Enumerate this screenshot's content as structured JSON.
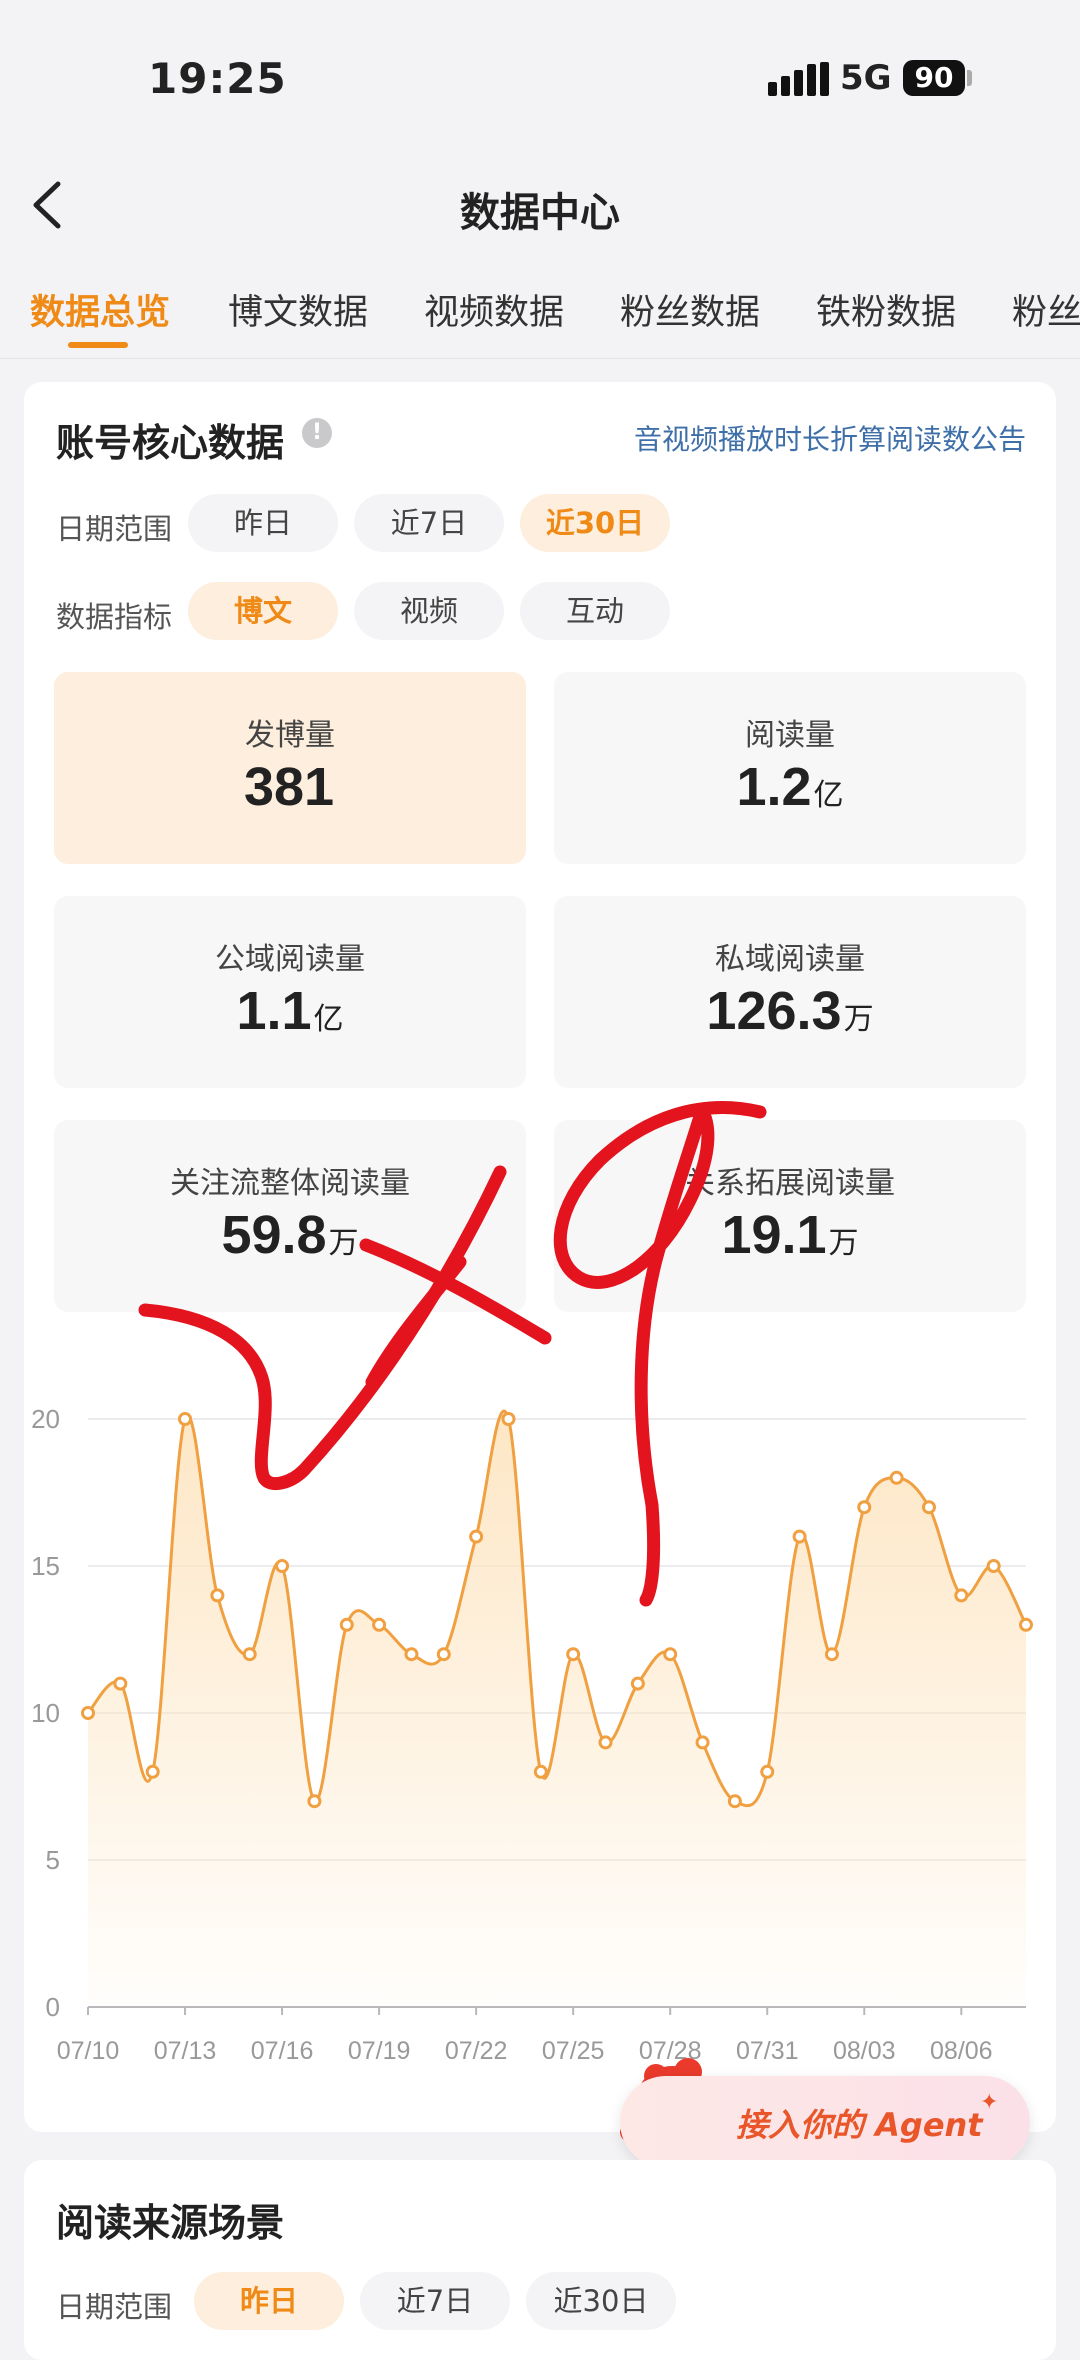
{
  "status_bar": {
    "time": "19:25",
    "network": "5G",
    "battery": "90"
  },
  "nav": {
    "title": "数据中心"
  },
  "tabs": [
    {
      "label": "数据总览",
      "active": true
    },
    {
      "label": "博文数据",
      "active": false
    },
    {
      "label": "视频数据",
      "active": false
    },
    {
      "label": "粉丝数据",
      "active": false
    },
    {
      "label": "铁粉数据",
      "active": false
    },
    {
      "label": "粉丝",
      "active": false
    }
  ],
  "core": {
    "title": "账号核心数据",
    "notice_link": "音视频播放时长折算阅读数公告",
    "date_label": "日期范围",
    "date_options": [
      "昨日",
      "近7日",
      "近30日"
    ],
    "date_selected": "近30日",
    "metric_label": "数据指标",
    "metric_options": [
      "博文",
      "视频",
      "互动"
    ],
    "metric_selected": "博文",
    "stats": [
      {
        "label": "发博量",
        "value": "381",
        "unit": ""
      },
      {
        "label": "阅读量",
        "value": "1.2",
        "unit": "亿"
      },
      {
        "label": "公域阅读量",
        "value": "1.1",
        "unit": "亿"
      },
      {
        "label": "私域阅读量",
        "value": "126.3",
        "unit": "万"
      },
      {
        "label": "关注流整体阅读量",
        "value": "59.8",
        "unit": "万"
      },
      {
        "label": "关系拓展阅读量",
        "value": "19.1",
        "unit": "万"
      }
    ]
  },
  "chart_data": {
    "type": "area",
    "title": "",
    "xlabel": "",
    "ylabel": "",
    "ylim": [
      0,
      20
    ],
    "yticks": [
      0,
      5,
      10,
      15,
      20
    ],
    "x_ticks": [
      "07/10",
      "07/13",
      "07/16",
      "07/19",
      "07/22",
      "07/25",
      "07/28",
      "07/31",
      "08/03",
      "08/06"
    ],
    "x": [
      "07/10",
      "07/11",
      "07/12",
      "07/13",
      "07/14",
      "07/15",
      "07/16",
      "07/17",
      "07/18",
      "07/19",
      "07/20",
      "07/21",
      "07/22",
      "07/23",
      "07/24",
      "07/25",
      "07/26",
      "07/27",
      "07/28",
      "07/29",
      "07/30",
      "07/31",
      "08/01",
      "08/02",
      "08/03",
      "08/04",
      "08/05",
      "08/06",
      "08/07",
      "08/08"
    ],
    "series": [
      {
        "values": [
          10,
          11,
          8,
          20,
          14,
          12,
          15,
          7,
          13,
          13,
          12,
          12,
          16,
          20,
          8,
          12,
          9,
          11,
          12,
          9,
          7,
          8,
          16,
          12,
          17,
          18,
          17,
          14,
          15,
          13
        ]
      }
    ],
    "grid": true,
    "color": "#f0a040",
    "fill_color": "#fde5c2"
  },
  "agent": {
    "label": "接入你的 Agent"
  },
  "source": {
    "title": "阅读来源场景",
    "date_label": "日期范围",
    "date_options": [
      "昨日",
      "近7日",
      "近30日"
    ],
    "date_selected": "昨日"
  },
  "overlay": {
    "marker_color": "#e4141e"
  }
}
